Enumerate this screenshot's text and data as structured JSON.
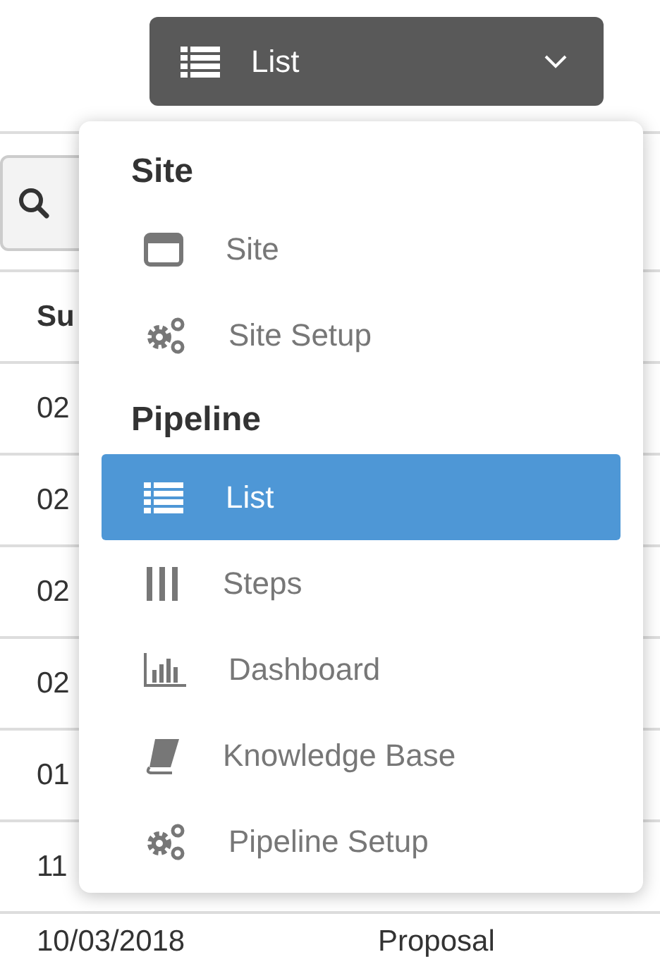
{
  "view_button": {
    "label": "List",
    "kind": "list"
  },
  "table": {
    "header": "Su",
    "rows": [
      [
        "02"
      ],
      [
        "02"
      ],
      [
        "02"
      ],
      [
        "02"
      ],
      [
        "01"
      ],
      [
        "11"
      ],
      [
        "10/03/2018",
        "Proposal"
      ]
    ]
  },
  "menu": {
    "sections": [
      {
        "title": "Site",
        "items": [
          {
            "label": "Site",
            "kind": "window",
            "selected": false
          },
          {
            "label": "Site Setup",
            "kind": "gears",
            "selected": false
          }
        ]
      },
      {
        "title": "Pipeline",
        "items": [
          {
            "label": "List",
            "kind": "list",
            "selected": true
          },
          {
            "label": "Steps",
            "kind": "columns",
            "selected": false
          },
          {
            "label": "Dashboard",
            "kind": "chart",
            "selected": false
          },
          {
            "label": "Knowledge Base",
            "kind": "book",
            "selected": false
          },
          {
            "label": "Pipeline Setup",
            "kind": "gears",
            "selected": false
          }
        ]
      }
    ]
  }
}
